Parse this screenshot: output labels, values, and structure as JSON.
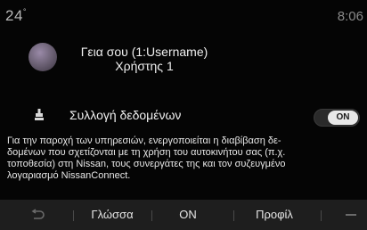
{
  "status": {
    "temperature": "24",
    "temperature_unit": "°",
    "time": "8:06"
  },
  "profile": {
    "greeting": "Γεια σου  (1:Username)",
    "user_name": "Χρήστης 1"
  },
  "data_collection": {
    "label": "Συλλογή δεδομένων",
    "toggle_state": "ON",
    "toggle_on": true
  },
  "info": {
    "lines": [
      "Για την παροχή των υπηρεσιών, ενεργοποιείται η διαβίβαση δε-",
      "δομένων που σχετίζονται με τη χρήση του αυτοκινήτου σας (π.χ.",
      "τοποθεσία) στη Nissan, τους συνεργάτες της και τον συζευγμένο",
      "λογαριασμό NissanConnect."
    ]
  },
  "bottom_bar": {
    "language_label": "Γλώσσα",
    "on_label": "ON",
    "profile_label": "Προφίλ"
  },
  "icons": {
    "back": "back-arrow-icon",
    "data": "data-collection-icon",
    "more": "more-icon"
  }
}
